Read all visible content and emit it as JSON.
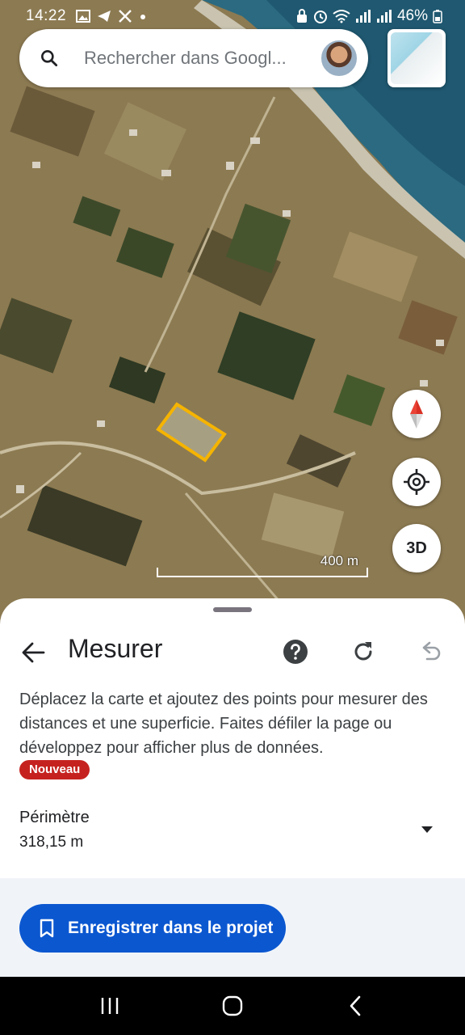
{
  "status_bar": {
    "time": "14:22",
    "battery": "46%"
  },
  "search": {
    "placeholder": "Rechercher dans Googl..."
  },
  "map": {
    "scale_label": "400 m",
    "button_3d": "3D"
  },
  "sheet": {
    "title": "Mesurer",
    "description": "Déplacez la carte et ajoutez des points pour mesurer des distances et une superficie. Faites défiler la page ou développez pour afficher plus de données.",
    "badge": "Nouveau",
    "metric_label": "Périmètre",
    "metric_value": "318,15 m",
    "save_label": "Enregistrer dans le projet"
  },
  "colors": {
    "primary": "#0b57d0",
    "badge": "#c5221f",
    "measure_polygon": "#f5b400"
  },
  "icons": [
    "search-icon",
    "back-arrow-icon",
    "help-icon",
    "refresh-icon",
    "undo-icon",
    "compass-icon",
    "my-location-icon",
    "bookmark-icon"
  ]
}
